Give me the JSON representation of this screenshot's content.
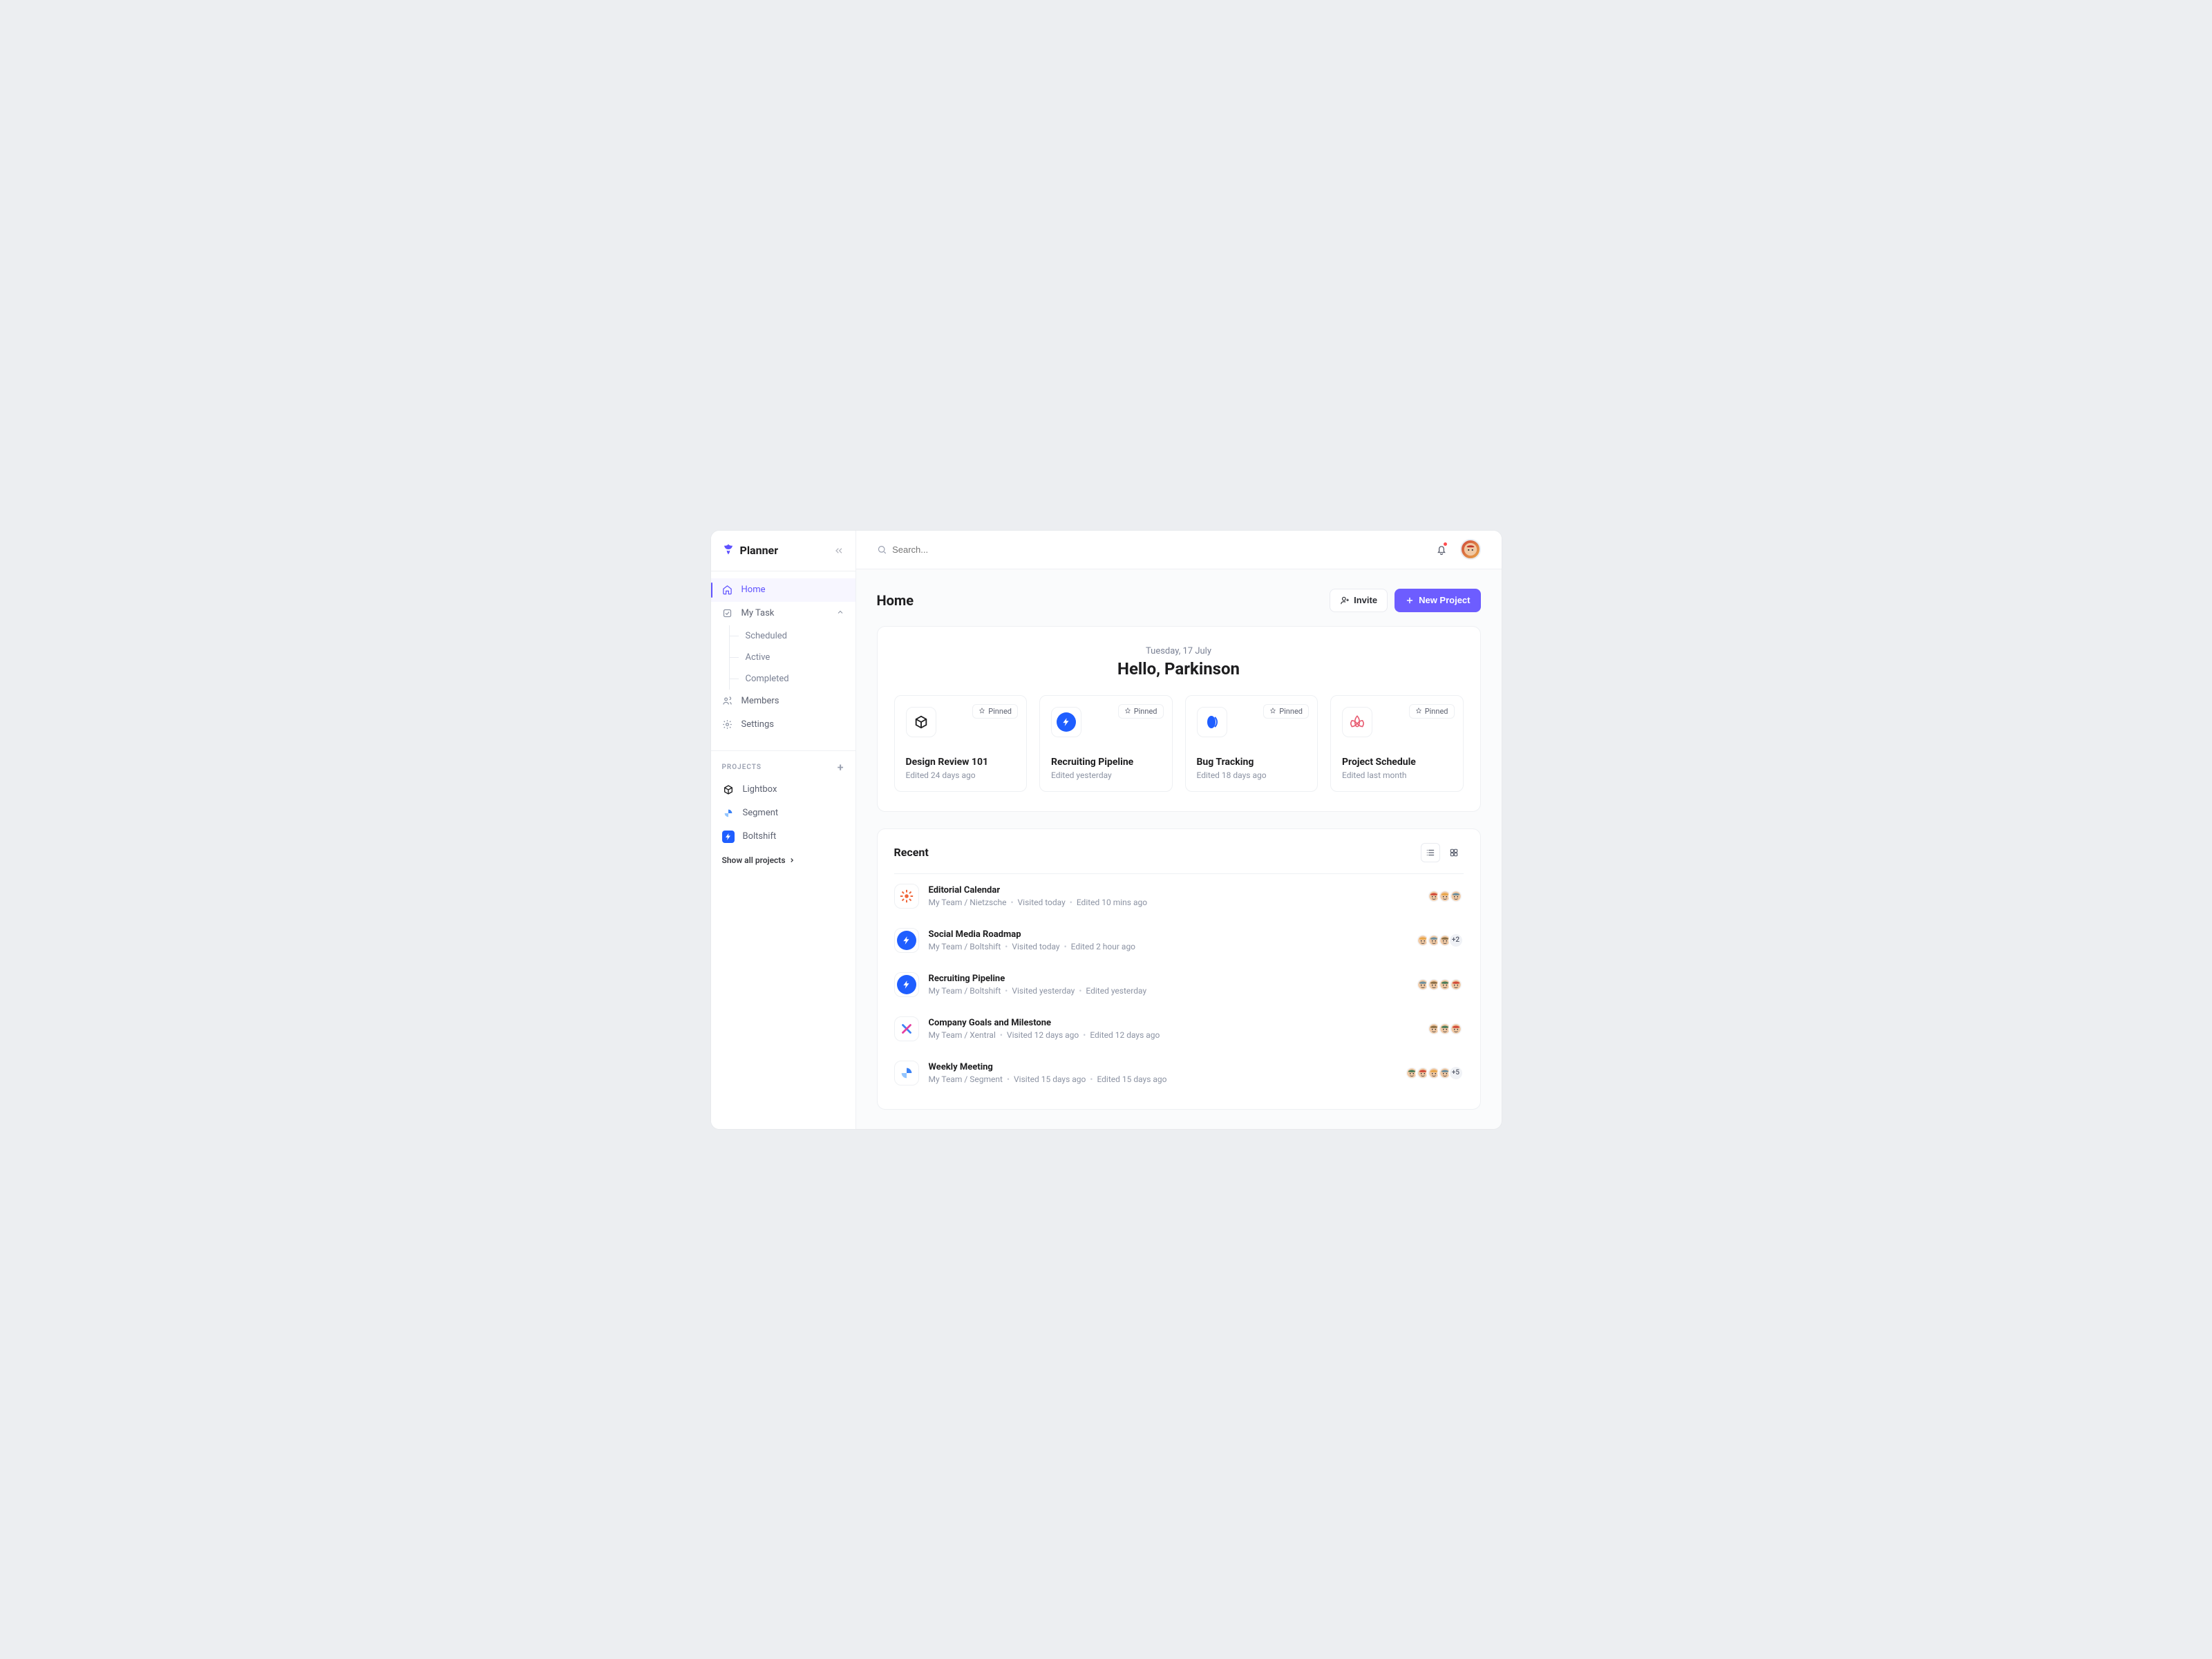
{
  "app_name": "Planner",
  "sidebar": {
    "nav": {
      "home": "Home",
      "my_task": "My Task",
      "sub": {
        "scheduled": "Scheduled",
        "active": "Active",
        "completed": "Completed"
      },
      "members": "Members",
      "settings": "Settings"
    },
    "projects_label": "PROJECTS",
    "projects": [
      {
        "name": "Lightbox"
      },
      {
        "name": "Segment"
      },
      {
        "name": "Boltshift"
      }
    ],
    "show_all": "Show all projects"
  },
  "topbar": {
    "search_placeholder": "Search..."
  },
  "page": {
    "title": "Home",
    "invite": "Invite",
    "new_project": "New Project",
    "date": "Tuesday, 17 July",
    "greeting": "Hello, Parkinson",
    "pinned_label": "Pinned",
    "pinned": [
      {
        "title": "Design Review 101",
        "sub": "Edited 24 days ago",
        "icon": "cube"
      },
      {
        "title": "Recruiting Pipeline",
        "sub": "Edited yesterday",
        "icon": "bolt"
      },
      {
        "title": "Bug Tracking",
        "sub": "Edited 18 days ago",
        "icon": "oval"
      },
      {
        "title": "Project Schedule",
        "sub": "Edited last month",
        "icon": "lotus"
      }
    ],
    "recent_title": "Recent",
    "recent": [
      {
        "title": "Editorial Calendar",
        "path": "My Team / Nietzsche",
        "visited": "Visited today",
        "edited": "Edited 10 mins ago",
        "icon": "sun",
        "avatars": 3,
        "extra": ""
      },
      {
        "title": "Social Media Roadmap",
        "path": "My Team / Boltshift",
        "visited": "Visited today",
        "edited": "Edited 2 hour ago",
        "icon": "bolt",
        "avatars": 3,
        "extra": "+2"
      },
      {
        "title": "Recruiting Pipeline",
        "path": "My Team / Boltshift",
        "visited": "Visited yesterday",
        "edited": "Edited yesterday",
        "icon": "bolt",
        "avatars": 4,
        "extra": ""
      },
      {
        "title": "Company Goals and Milestone",
        "path": "My Team / Xentral",
        "visited": "Visited 12 days ago",
        "edited": "Edited 12 days ago",
        "icon": "xentral",
        "avatars": 3,
        "extra": ""
      },
      {
        "title": "Weekly Meeting",
        "path": "My Team / Segment",
        "visited": "Visited 15 days ago",
        "edited": "Edited 15 days ago",
        "icon": "segment",
        "avatars": 4,
        "extra": "+5"
      }
    ]
  }
}
